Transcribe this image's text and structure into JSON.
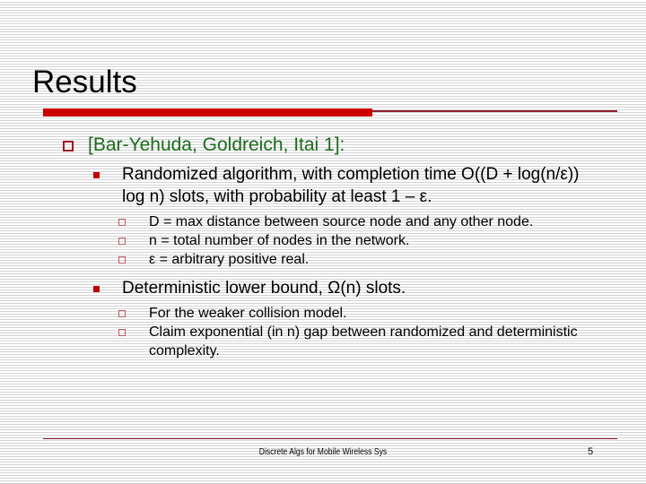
{
  "slide": {
    "title": "Results",
    "accent_color": "#cc0000",
    "rule_color": "#8d2030",
    "level1_text_color": "#1c6b1c",
    "bullet_level1_icon": "hollow-square-bullet",
    "bullet_level2_icon": "filled-square-bullet",
    "bullet_level3_icon": "hollow-square-bullet-small"
  },
  "content": {
    "citation": "[Bar-Yehuda, Goldreich, Itai 1]:",
    "items": [
      {
        "text": "Randomized algorithm, with completion time O((D + log(n/ε)) log n) slots, with probability at least 1 – ε.",
        "subitems": [
          "D = max distance between source node and any other node.",
          "n = total number of nodes in the network.",
          "ε = arbitrary positive real."
        ]
      },
      {
        "text": "Deterministic lower bound, Ω(n) slots.",
        "subitems": [
          "For the weaker collision model.",
          "Claim exponential (in n) gap between randomized and deterministic complexity."
        ]
      }
    ]
  },
  "footer": {
    "text": "Discrete Algs for Mobile Wireless Sys",
    "page_number": "5"
  }
}
